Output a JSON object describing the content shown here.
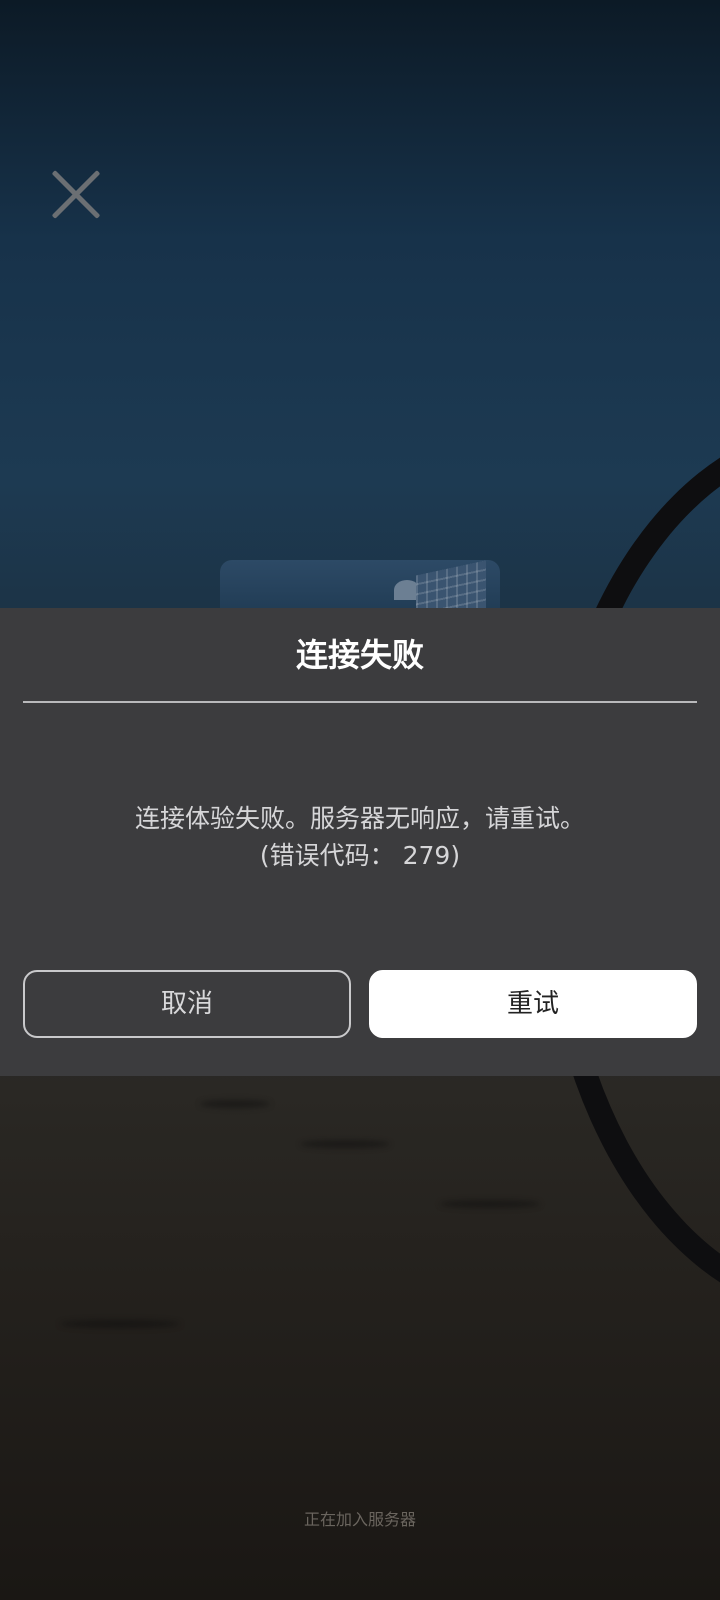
{
  "dialog": {
    "title": "连接失败",
    "message_line1": "连接体验失败。服务器无响应，请重试。",
    "message_line2": "(错误代码： 279)",
    "cancel_label": "取消",
    "retry_label": "重试"
  },
  "status": {
    "text": "正在加入服务器"
  },
  "icons": {
    "close": "close-icon"
  },
  "colors": {
    "dialog_bg": "#3c3c3e",
    "retry_button_bg": "#ffffff",
    "cancel_button_border": "#c9c9cb"
  }
}
